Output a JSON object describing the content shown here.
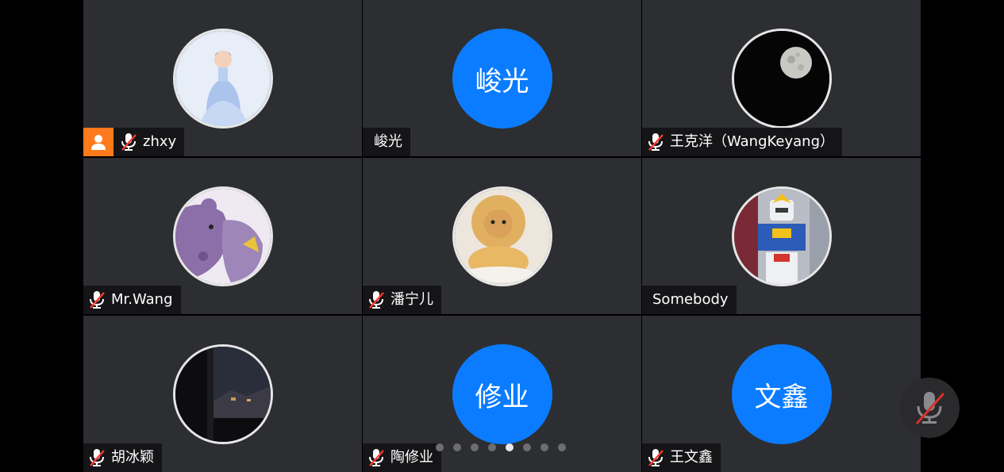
{
  "participants": [
    {
      "name": "zhxy",
      "avatar_type": "photo",
      "avatar_icon": "girl-in-blue-dress-photo",
      "muted": true,
      "is_host": true
    },
    {
      "name": "峻光",
      "avatar_type": "initials",
      "avatar_text": "峻光",
      "muted": false,
      "is_host": false
    },
    {
      "name": "王克洋（WangKeyang）",
      "avatar_type": "photo",
      "avatar_icon": "moon-photo",
      "muted": true,
      "is_host": false
    },
    {
      "name": "Mr.Wang",
      "avatar_type": "photo",
      "avatar_icon": "cartoon-bear-photo",
      "muted": true,
      "is_host": false
    },
    {
      "name": "潘宁儿",
      "avatar_type": "photo",
      "avatar_icon": "cat-bread-photo",
      "muted": true,
      "is_host": false
    },
    {
      "name": "Somebody",
      "avatar_type": "photo",
      "avatar_icon": "gundam-robot-photo",
      "muted": false,
      "is_host": false
    },
    {
      "name": "胡冰颖",
      "avatar_type": "photo",
      "avatar_icon": "night-window-photo",
      "muted": true,
      "is_host": false
    },
    {
      "name": "陶修业",
      "avatar_type": "initials",
      "avatar_text": "修业",
      "muted": true,
      "is_host": false
    },
    {
      "name": "王文鑫",
      "avatar_type": "initials",
      "avatar_text": "文鑫",
      "muted": true,
      "is_host": false
    }
  ],
  "pagination": {
    "total_pages": 8,
    "current_page": 5
  },
  "mic_button": {
    "icon": "microphone-muted-icon",
    "state": "muted"
  },
  "colors": {
    "tile_bg": "#2d2e31",
    "initials_avatar_bg": "#0b7cff",
    "host_badge_bg": "#ff7a1c",
    "muted_slash": "#ff3b30"
  }
}
